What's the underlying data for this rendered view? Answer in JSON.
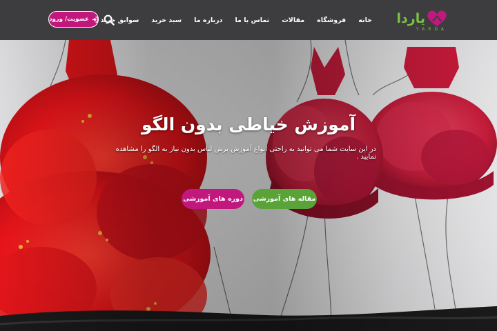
{
  "brand": {
    "name": "یاردا",
    "subtitle": "YARDA",
    "colors": {
      "green": "#7cc242",
      "magenta": "#c2187d",
      "header": "#3d3d3f"
    }
  },
  "nav": {
    "items": [
      {
        "label": "خانه"
      },
      {
        "label": "فروشگاه"
      },
      {
        "label": "مقالات"
      },
      {
        "label": "تماس با ما"
      },
      {
        "label": "درباره ما"
      },
      {
        "label": "سبد خرید"
      },
      {
        "label": "سوابق خرید"
      }
    ],
    "search_icon": "search-icon",
    "login": {
      "label": "عضویت/ ورود",
      "icon": "login-arrow-icon"
    }
  },
  "hero": {
    "title": "آموزش خیاطی بدون الگو",
    "subtitle": "در این سایت شما می توانید به راحتی انواع آموزش برش لباس بدون نیاز به الگو را مشاهده نمایید .",
    "buttons": {
      "articles": "مقاله های آموزشی",
      "courses": "دوره های آموزشی"
    }
  }
}
